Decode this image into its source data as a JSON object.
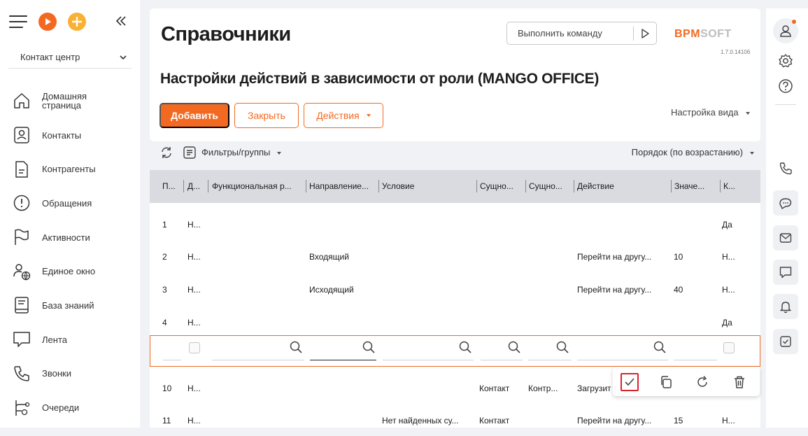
{
  "sidebar": {
    "workspace": "Контакт центр",
    "nav": [
      {
        "label": "Домашняя страница",
        "icon": "home-icon"
      },
      {
        "label": "Контакты",
        "icon": "contact-icon"
      },
      {
        "label": "Контрагенты",
        "icon": "document-icon"
      },
      {
        "label": "Обращения",
        "icon": "alert-icon"
      },
      {
        "label": "Активности",
        "icon": "flag-icon"
      },
      {
        "label": "Единое окно",
        "icon": "person-globe-icon"
      },
      {
        "label": "База знаний",
        "icon": "book-icon"
      },
      {
        "label": "Лента",
        "icon": "chat-bubble-icon"
      },
      {
        "label": "Звонки",
        "icon": "phone-icon"
      },
      {
        "label": "Очереди",
        "icon": "queue-icon"
      }
    ]
  },
  "header": {
    "title": "Справочники",
    "command_placeholder": "Выполнить команду",
    "logo_part1": "BPM",
    "logo_part2": "SOFT",
    "version": "1.7.0.14106"
  },
  "page": {
    "subtitle": "Настройки действий в зависимости от роли (MANGO OFFICE)",
    "add_label": "Добавить",
    "close_label": "Закрыть",
    "actions_label": "Действия",
    "view_settings": "Настройка вида",
    "filters_label": "Фильтры/группы",
    "order_label": "Порядок (по возрастанию)"
  },
  "grid": {
    "columns": [
      "П...",
      "Д...",
      "Функциональная р...",
      "Направление...",
      "Условие",
      "Сущно...",
      "Сущно...",
      "Действие",
      "Значе...",
      "К..."
    ],
    "rows": [
      [
        "1",
        "Н...",
        "",
        "",
        "",
        "",
        "",
        "",
        "",
        "Да"
      ],
      [
        "2",
        "Н...",
        "",
        "Входящий",
        "",
        "",
        "",
        "Перейти на другу...",
        "10",
        "Н..."
      ],
      [
        "3",
        "Н...",
        "",
        "Исходящий",
        "",
        "",
        "",
        "Перейти на другу...",
        "40",
        "Н..."
      ],
      [
        "4",
        "Н...",
        "",
        "",
        "",
        "",
        "",
        "",
        "",
        "Да"
      ]
    ],
    "rows_after": [
      [
        "10",
        "Н...",
        "",
        "",
        "",
        "Контакт",
        "Контр...",
        "Загрузит",
        "",
        ""
      ],
      [
        "11",
        "Н...",
        "",
        "",
        "Нет найденных су...",
        "Контакт",
        "",
        "Перейти на другу...",
        "15",
        "Н..."
      ]
    ]
  },
  "colors": {
    "accent": "#f26a21",
    "accent2": "#f8b133",
    "highlight": "#d9232d"
  }
}
